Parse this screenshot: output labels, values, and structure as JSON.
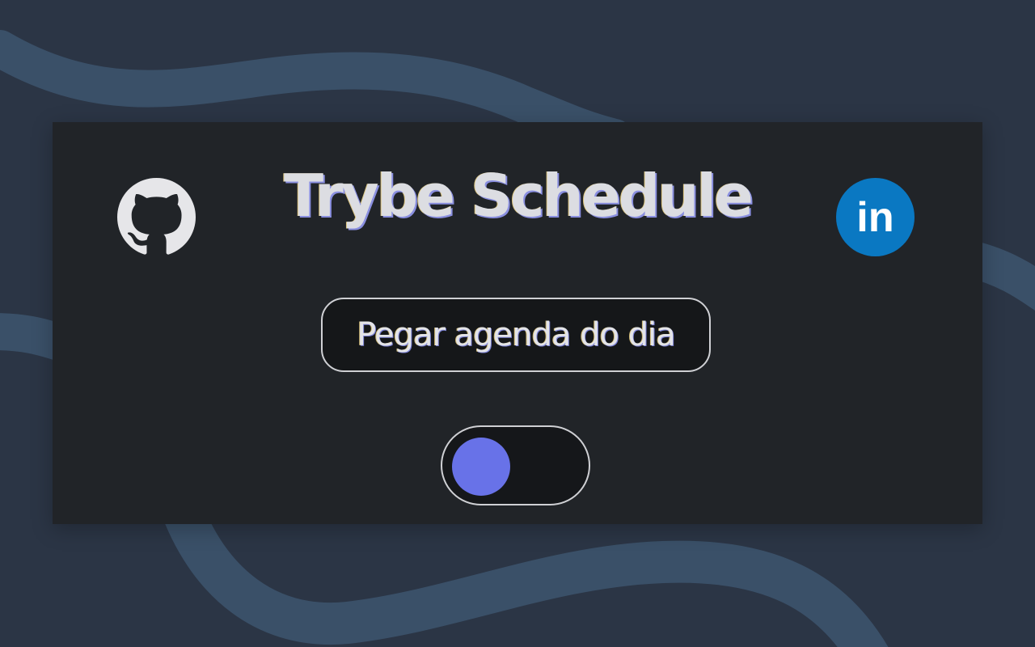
{
  "app": {
    "title": "Trybe Schedule"
  },
  "actions": {
    "fetch_label": "Pegar agenda do dia"
  },
  "social": {
    "github_icon": "github-icon",
    "linkedin_icon": "linkedin-icon",
    "linkedin_text": "in"
  },
  "toggle": {
    "state": "off",
    "knob_position": "left"
  },
  "colors": {
    "background": "#2b3545",
    "wave": "#3a5068",
    "card": "#212428",
    "title_text": "#dcdde2",
    "button_border": "#cfd0d4",
    "toggle_knob": "#6872e8",
    "github_icon": "#e6e6e9",
    "linkedin_brand": "#0a78c2"
  }
}
